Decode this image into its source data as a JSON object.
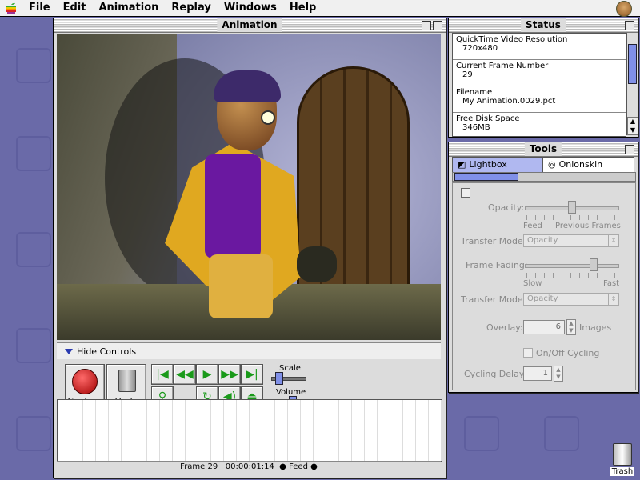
{
  "menubar": {
    "apple_icon": "apple-icon",
    "items": [
      "File",
      "Edit",
      "Animation",
      "Replay",
      "Windows",
      "Help"
    ],
    "app_icon": "app-face-icon"
  },
  "animation_window": {
    "title": "Animation",
    "hide_controls_label": "Hide Controls",
    "capture_label": "Capture",
    "undo_label": "Undo",
    "scale_label": "Scale",
    "volume_label": "Volume",
    "scale_level": 0.15,
    "volume_level": 0.65,
    "transport_icons": [
      "first-frame-icon",
      "rewind-icon",
      "play-icon",
      "fast-forward-icon",
      "last-frame-icon"
    ],
    "tool_icons": [
      "magnifier-icon",
      "loop-icon",
      "speaker-icon",
      "eject-icon"
    ],
    "status": {
      "frame": "Frame 29",
      "timecode": "00:00:01:14",
      "mode": "Feed"
    }
  },
  "status_window": {
    "title": "Status",
    "items": [
      {
        "label": "QuickTime Video Resolution",
        "value": "720x480"
      },
      {
        "label": "Current Frame Number",
        "value": "29"
      },
      {
        "label": "Filename",
        "value": "My Animation.0029.pct"
      },
      {
        "label": "Free Disk Space",
        "value": "346MB"
      }
    ]
  },
  "tools_window": {
    "title": "Tools",
    "tabs": [
      {
        "label": "Lightbox",
        "icon": "lightbox-icon",
        "active": true
      },
      {
        "label": "Onionskin",
        "icon": "onionskin-icon",
        "active": false
      }
    ],
    "opacity_label": "Opacity:",
    "opacity_left": "Feed",
    "opacity_right": "Previous Frames",
    "opacity_level": 0.5,
    "transfer_mode_label": "Transfer Mode:",
    "transfer_mode_value": "Opacity",
    "frame_fading_label": "Frame Fading:",
    "frame_fading_left": "Slow",
    "frame_fading_right": "Fast",
    "frame_fading_level": 0.75,
    "transfer_mode2_label": "Transfer Mode:",
    "transfer_mode2_value": "Opacity",
    "overlay_label": "Overlay:",
    "overlay_value": "6",
    "overlay_unit": "Images",
    "onoff_label": "On/Off Cycling",
    "cycling_delay_label": "Cycling Delay:",
    "cycling_delay_value": "1"
  },
  "desktop": {
    "trash_label": "Trash"
  }
}
